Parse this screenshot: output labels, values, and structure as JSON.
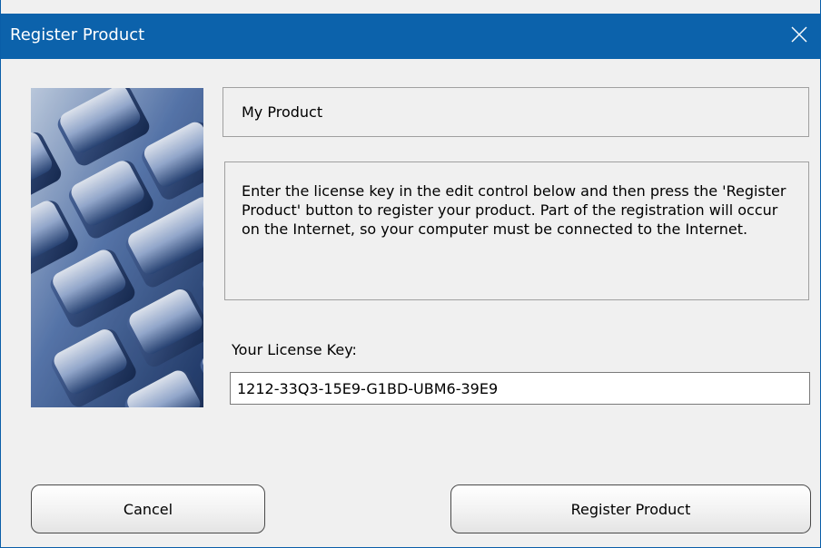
{
  "window": {
    "title": "Register Product"
  },
  "icons": {
    "close": "close-icon",
    "image": "keyboard-photo"
  },
  "product": {
    "name": "My Product"
  },
  "instructions": {
    "text": "Enter the license key in the edit control below and then press the 'Register Product' button to register your product. Part of the registration will occur on the Internet, so your computer must be connected to the Internet."
  },
  "license": {
    "label": "Your License Key:",
    "value": "1212-33Q3-15E9-G1BD-UBM6-39E9"
  },
  "buttons": {
    "cancel": "Cancel",
    "register": "Register Product"
  },
  "colors": {
    "titlebar": "#0c62ab",
    "background": "#f0f0f0"
  }
}
